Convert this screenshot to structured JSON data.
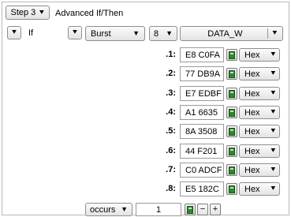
{
  "header": {
    "step_label": "Step 3",
    "title": "Advanced If/Then"
  },
  "condition": {
    "if_label": "If",
    "trigger_type": "Burst",
    "count": "8",
    "bus_name": "DATA_W"
  },
  "rows": [
    {
      "label": ".1:",
      "value": "E8 C0FA",
      "format": "Hex"
    },
    {
      "label": ".2:",
      "value": "77 DB9A",
      "format": "Hex"
    },
    {
      "label": ".3:",
      "value": "E7 EDBF",
      "format": "Hex"
    },
    {
      "label": ".4:",
      "value": "A1 6635",
      "format": "Hex"
    },
    {
      "label": ".5:",
      "value": "8A 3508",
      "format": "Hex"
    },
    {
      "label": ".6:",
      "value": "44 F201",
      "format": "Hex"
    },
    {
      "label": ".7:",
      "value": "C0 ADCF",
      "format": "Hex"
    },
    {
      "label": ".8:",
      "value": "E5 182C",
      "format": "Hex"
    }
  ],
  "footer": {
    "occurs_label": "occurs",
    "occurs_value": "1",
    "minus": "−",
    "plus": "+"
  },
  "icons": {
    "chevron": "double-chevron-down-icon",
    "dropdown": "triangle-down-icon",
    "calculator": "calculator-icon"
  }
}
